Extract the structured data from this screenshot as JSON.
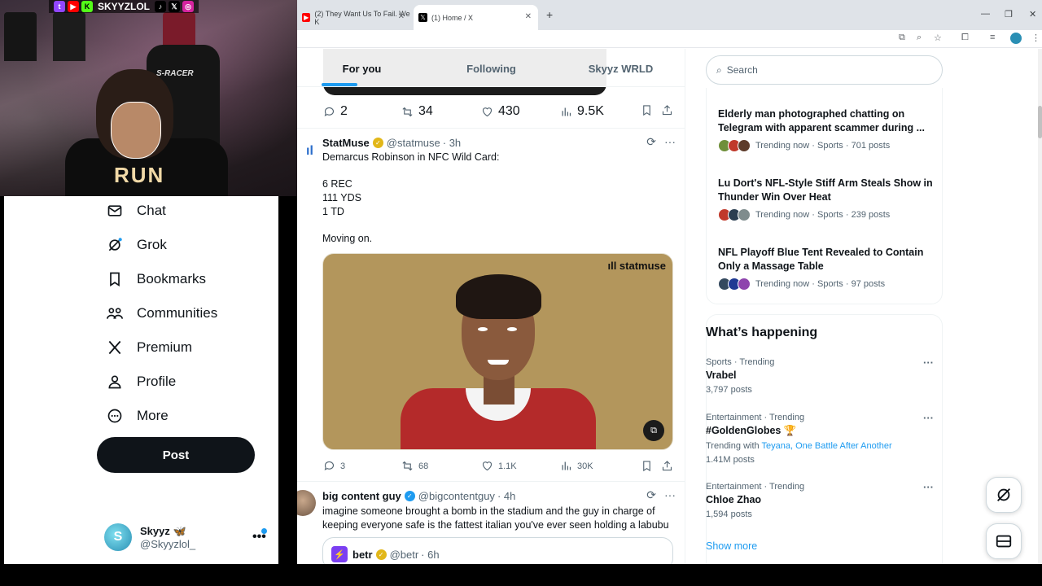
{
  "overlay": {
    "handle": "SKYYZLOL",
    "social_icons": [
      "twitch-icon",
      "youtube-icon",
      "kick-icon",
      "tiktok-icon",
      "x-icon",
      "instagram-icon"
    ],
    "chair_label": "S-RACER",
    "shirt_text": "RUN"
  },
  "browser": {
    "tabs": [
      {
        "title": "(2) They Want Us To Fail. We K",
        "active": false
      },
      {
        "title": "(1) Home / X",
        "active": true
      }
    ]
  },
  "nav": {
    "items": [
      {
        "label": "Chat",
        "icon": "envelope-icon"
      },
      {
        "label": "Grok",
        "icon": "grok-icon"
      },
      {
        "label": "Bookmarks",
        "icon": "bookmark-icon"
      },
      {
        "label": "Communities",
        "icon": "communities-icon"
      },
      {
        "label": "Premium",
        "icon": "x-logo-icon"
      },
      {
        "label": "Profile",
        "icon": "person-icon"
      },
      {
        "label": "More",
        "icon": "more-circle-icon"
      }
    ],
    "post_label": "Post",
    "account": {
      "name": "Skyyz 🦋",
      "handle": "@Skyyzlol_",
      "more": "•••"
    }
  },
  "timeline": {
    "tabs": [
      "For you",
      "Following",
      "Skyyz WRLD"
    ],
    "prev_actions": {
      "replies": "2",
      "reposts": "34",
      "likes": "430",
      "views": "9.5K"
    },
    "posts": [
      {
        "name": "StatMuse",
        "handle": "@statmuse",
        "time": "· 3h",
        "lines": [
          "Demarcus Robinson in NFC Wild Card:",
          "",
          "6 REC",
          "111 YDS",
          "1 TD",
          "",
          "Moving on."
        ],
        "media_brand": "statmuse",
        "actions": {
          "replies": "3",
          "reposts": "68",
          "likes": "1.1K",
          "views": "30K"
        }
      },
      {
        "name": "big content guy",
        "handle": "@bigcontentguy",
        "time": "· 4h",
        "lines": [
          "imagine someone brought a bomb in the stadium and the guy in charge of",
          "keeping everyone safe is the fattest italian you've ever seen holding a labubu"
        ],
        "quote": {
          "name": "betr",
          "handle": "@betr",
          "time": "· 6h"
        }
      }
    ]
  },
  "sidebar": {
    "search_placeholder": "Search",
    "news": [
      {
        "title": "Elderly man photographed chatting on Telegram with apparent scammer during ...",
        "meta": "Trending now · Sports · 701 posts"
      },
      {
        "title": "Lu Dort's NFL-Style Stiff Arm Steals Show in Thunder Win Over Heat",
        "meta": "Trending now · Sports · 239 posts"
      },
      {
        "title": "NFL Playoff Blue Tent Revealed to Contain Only a Massage Table",
        "meta": "Trending now · Sports · 97 posts"
      }
    ],
    "whats_happening": "What’s happening",
    "trends": [
      {
        "category": "Sports · Trending",
        "name": "Vrabel",
        "count": "3,797 posts"
      },
      {
        "category": "Entertainment · Trending",
        "name": "#GoldenGlobes 🏆",
        "with_label": "Trending with",
        "with_links": "Teyana, One Battle After Another",
        "count": "1.41M posts"
      },
      {
        "category": "Entertainment · Trending",
        "name": "Chloe Zhao",
        "count": "1,594 posts"
      }
    ],
    "show_more": "Show more"
  }
}
